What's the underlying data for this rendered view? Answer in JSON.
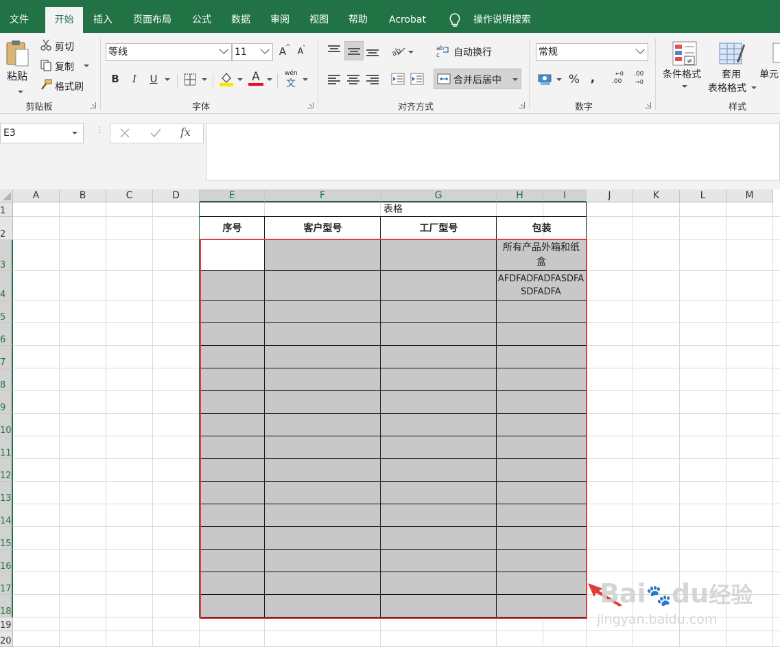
{
  "tabs": [
    "文件",
    "开始",
    "插入",
    "页面布局",
    "公式",
    "数据",
    "审阅",
    "视图",
    "帮助",
    "Acrobat"
  ],
  "tell_me": "操作说明搜索",
  "clipboard": {
    "paste": "粘贴",
    "cut": "剪切",
    "copy": "复制",
    "format_painter": "格式刷",
    "group": "剪贴板"
  },
  "font": {
    "name": "等线",
    "size": "11",
    "bold": "B",
    "italic": "I",
    "underline": "U",
    "grow": "A",
    "shrink": "A",
    "font_color_letter": "A",
    "wen": "文",
    "wen_pinyin": "wén",
    "group": "字体"
  },
  "alignment": {
    "wrap": "自动换行",
    "merge": "合并后居中",
    "group": "对齐方式"
  },
  "number": {
    "format": "常规",
    "percent": "%",
    "comma": ",",
    "inc_decimal": ".00",
    "dec_decimal": ".00",
    "group": "数字"
  },
  "styles": {
    "conditional": "条件格式",
    "table_format_1": "套用",
    "table_format_2": "表格格式",
    "cell_styles": "单元",
    "group": "样式"
  },
  "formula_bar": {
    "name_box": "E3",
    "fx": "fx"
  },
  "columns": [
    "A",
    "B",
    "C",
    "D",
    "E",
    "F",
    "G",
    "H",
    "I",
    "J",
    "K",
    "L",
    "M"
  ],
  "rows": [
    "1",
    "2",
    "3",
    "4",
    "5",
    "6",
    "7",
    "8",
    "9",
    "10",
    "11",
    "12",
    "13",
    "14",
    "15",
    "16",
    "17",
    "18",
    "19",
    "20"
  ],
  "sheet": {
    "title": "表格",
    "headers": [
      "序号",
      "客户型号",
      "工厂型号",
      "包装"
    ],
    "h3": "所有产品外箱和纸盒",
    "h4": "AFDFADFADFASDFASDFADFA"
  },
  "watermark": {
    "brand": "Bai",
    "brand2": "du",
    "jingyan": "经验",
    "url": "jingyan.baidu.com"
  },
  "colors": {
    "accent": "#217346",
    "selection_border": "#e03c3c",
    "fill_gray": "#c8c8c8",
    "font_color": "#e81123",
    "highlight": "#ffe600"
  }
}
